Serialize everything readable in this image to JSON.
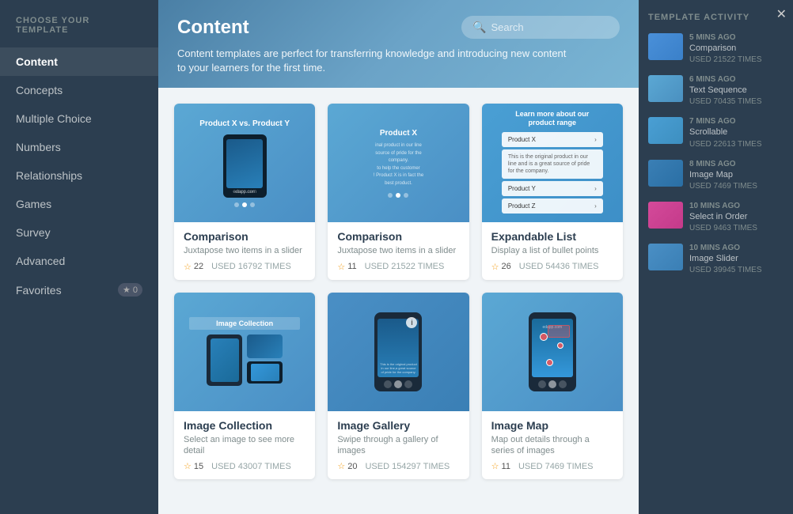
{
  "sidebar": {
    "title": "CHOOSE YOUR TEMPLATE",
    "items": [
      {
        "id": "content",
        "label": "Content",
        "active": true
      },
      {
        "id": "concepts",
        "label": "Concepts",
        "active": false
      },
      {
        "id": "multiple-choice",
        "label": "Multiple Choice",
        "active": false
      },
      {
        "id": "numbers",
        "label": "Numbers",
        "active": false
      },
      {
        "id": "relationships",
        "label": "Relationships",
        "active": false
      },
      {
        "id": "games",
        "label": "Games",
        "active": false
      },
      {
        "id": "survey",
        "label": "Survey",
        "active": false
      },
      {
        "id": "advanced",
        "label": "Advanced",
        "active": false
      },
      {
        "id": "favorites",
        "label": "Favorites",
        "active": false
      }
    ],
    "favorites_count": "0"
  },
  "main": {
    "title": "Content",
    "description": "Content templates are perfect for transferring knowledge and introducing new content to your learners for the first time.",
    "search_placeholder": "Search"
  },
  "templates": [
    {
      "id": "comparison-1",
      "name": "Comparison",
      "description": "Juxtapose two items in a slider",
      "rating": "22",
      "used": "USED 16792 TIMES",
      "thumb_type": "comparison1"
    },
    {
      "id": "comparison-2",
      "name": "Comparison",
      "description": "Juxtapose two items in a slider",
      "rating": "11",
      "used": "USED 21522 TIMES",
      "thumb_type": "comparison2"
    },
    {
      "id": "expandable-list",
      "name": "Expandable List",
      "description": "Display a list of bullet points",
      "rating": "26",
      "used": "USED 54436 TIMES",
      "thumb_type": "expandable"
    },
    {
      "id": "image-collection",
      "name": "Image Collection",
      "description": "Select an image to see more detail",
      "rating": "15",
      "used": "USED 43007 TIMES",
      "thumb_type": "image-collection"
    },
    {
      "id": "image-gallery",
      "name": "Image Gallery",
      "description": "Swipe through a gallery of images",
      "rating": "20",
      "used": "USED 154297 TIMES",
      "thumb_type": "image-gallery"
    },
    {
      "id": "image-map",
      "name": "Image Map",
      "description": "Map out details through a series of images",
      "rating": "11",
      "used": "USED 7469 TIMES",
      "thumb_type": "image-map"
    }
  ],
  "activity_panel": {
    "title": "TEMPLATE ACTIVITY",
    "items": [
      {
        "time": "5 MINS AGO",
        "name": "Comparison",
        "used": "USED 21522 TIMES",
        "thumb_class": "activity-thumb-1"
      },
      {
        "time": "6 MINS AGO",
        "name": "Text Sequence",
        "used": "USED 70435 TIMES",
        "thumb_class": "activity-thumb-2"
      },
      {
        "time": "7 MINS AGO",
        "name": "Scrollable",
        "used": "USED 22613 TIMES",
        "thumb_class": "activity-thumb-3"
      },
      {
        "time": "8 MINS AGO",
        "name": "Image Map",
        "used": "USED 7469 TIMES",
        "thumb_class": "activity-thumb-4"
      },
      {
        "time": "10 MINS AGO",
        "name": "Select in Order",
        "used": "USED 9463 TIMES",
        "thumb_class": "activity-thumb-5"
      },
      {
        "time": "10 MINS AGO",
        "name": "Image Slider",
        "used": "USED 39945 TIMES",
        "thumb_class": "activity-thumb-6"
      }
    ]
  },
  "icons": {
    "search": "🔍",
    "star": "☆",
    "star_filled": "★",
    "close": "✕",
    "chevron_right": "›",
    "favorites_star": "★"
  }
}
